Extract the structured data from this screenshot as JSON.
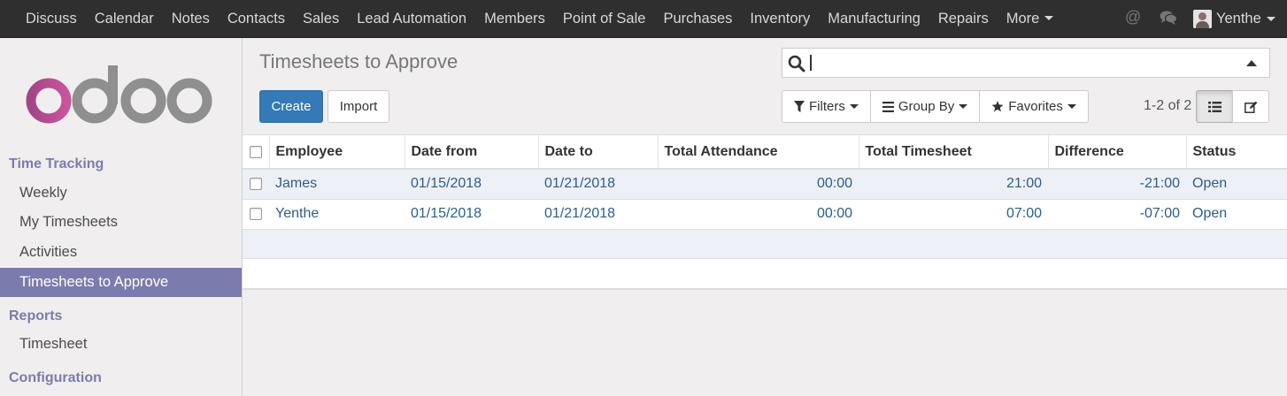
{
  "navbar": {
    "menu": [
      {
        "key": "discuss",
        "label": "Discuss"
      },
      {
        "key": "calendar",
        "label": "Calendar"
      },
      {
        "key": "notes",
        "label": "Notes"
      },
      {
        "key": "contacts",
        "label": "Contacts"
      },
      {
        "key": "sales",
        "label": "Sales"
      },
      {
        "key": "lead-automation",
        "label": "Lead Automation"
      },
      {
        "key": "members",
        "label": "Members"
      },
      {
        "key": "point-of-sale",
        "label": "Point of Sale"
      },
      {
        "key": "purchases",
        "label": "Purchases"
      },
      {
        "key": "inventory",
        "label": "Inventory"
      },
      {
        "key": "manufacturing",
        "label": "Manufacturing"
      },
      {
        "key": "repairs",
        "label": "Repairs"
      }
    ],
    "more_label": "More",
    "at_symbol": "@",
    "user_name": "Yenthe"
  },
  "sidebar": {
    "logo_text": "odoo",
    "section_time_tracking": "Time Tracking",
    "items": [
      {
        "key": "weekly",
        "label": "Weekly"
      },
      {
        "key": "my-timesheets",
        "label": "My Timesheets"
      },
      {
        "key": "activities",
        "label": "Activities"
      },
      {
        "key": "timesheets-to-approve",
        "label": "Timesheets to Approve",
        "active": true
      }
    ],
    "section_reports": "Reports",
    "report_item": "Timesheet",
    "section_configuration": "Configuration"
  },
  "control": {
    "title": "Timesheets to Approve",
    "create_label": "Create",
    "import_label": "Import",
    "search_value": "",
    "filters_label": "Filters",
    "groupby_label": "Group By",
    "favorites_label": "Favorites",
    "pager": "1-2 of 2"
  },
  "table": {
    "columns": [
      "Employee",
      "Date from",
      "Date to",
      "Total Attendance",
      "Total Timesheet",
      "Difference",
      "Status"
    ],
    "rows": [
      {
        "employee": "James",
        "date_from": "01/15/2018",
        "date_to": "01/21/2018",
        "attendance": "00:00",
        "timesheet": "21:00",
        "difference": "-21:00",
        "status": "Open"
      },
      {
        "employee": "Yenthe",
        "date_from": "01/15/2018",
        "date_to": "01/21/2018",
        "attendance": "00:00",
        "timesheet": "07:00",
        "difference": "-07:00",
        "status": "Open"
      }
    ]
  },
  "colors": {
    "navbar_bg": "#2f2f2f",
    "accent": "#7c7bad",
    "primary_button": "#337ab7",
    "link": "#2d5d8b"
  }
}
